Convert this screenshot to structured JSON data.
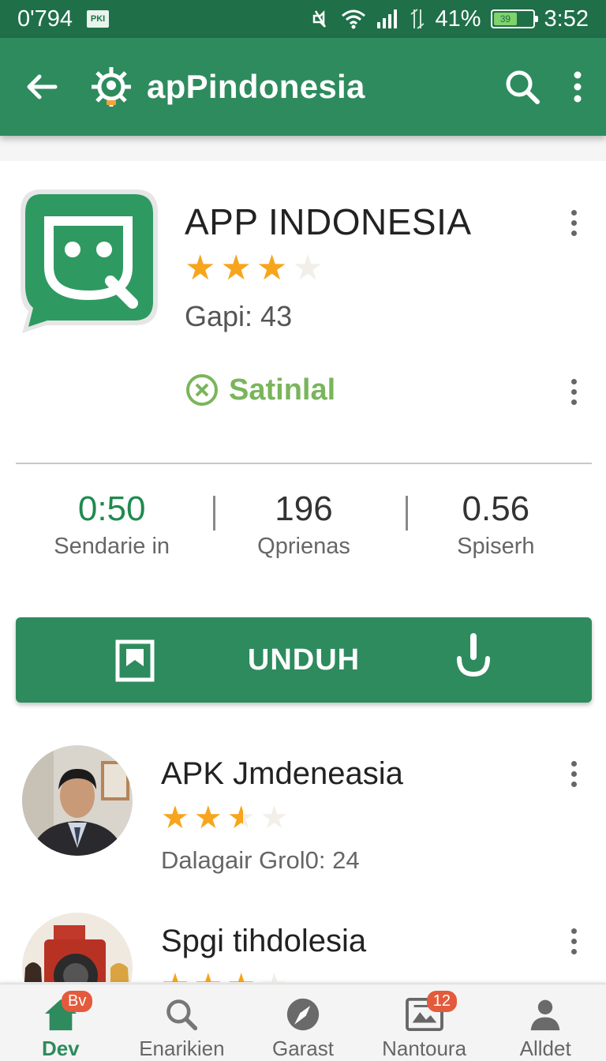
{
  "status_bar": {
    "left_text": "0'794",
    "sim_label": "PKI",
    "battery_percent": "41%",
    "battery_inner": "39",
    "time": "3:52"
  },
  "app_bar": {
    "title": "apPindonesia",
    "icons": [
      "back-arrow-icon",
      "gear-logo-icon",
      "search-icon",
      "more-vert-icon"
    ]
  },
  "app": {
    "name": "APP  INDONESIA",
    "rating_stars": 3,
    "rating_max": 4,
    "meta": "Gapi: 43",
    "status_label": "Satinlal",
    "accent": "#2e8b5e"
  },
  "stats": [
    {
      "value": "0:50",
      "label": "Sendarie in"
    },
    {
      "value": "196",
      "label": "Qprienas"
    },
    {
      "value": "0.56",
      "label": "Spiserh"
    }
  ],
  "download": {
    "label": "UNDUH"
  },
  "list": [
    {
      "title": "APK Jmdeneasia",
      "stars": 2.5,
      "subtitle": "Dalagair Grol0: 24"
    },
    {
      "title": "Spgi tihdolesia",
      "stars": 3,
      "subtitle": ""
    }
  ],
  "bottom_nav": [
    {
      "label": "Dev",
      "badge": "Bv",
      "icon": "home-icon",
      "active": true
    },
    {
      "label": "Enarikien",
      "badge": "",
      "icon": "search-icon",
      "active": false
    },
    {
      "label": "Garast",
      "badge": "",
      "icon": "compass-icon",
      "active": false
    },
    {
      "label": "Nantoura",
      "badge": "12",
      "icon": "image-icon",
      "active": false
    },
    {
      "label": "Alldet",
      "badge": "",
      "icon": "person-icon",
      "active": false
    }
  ]
}
